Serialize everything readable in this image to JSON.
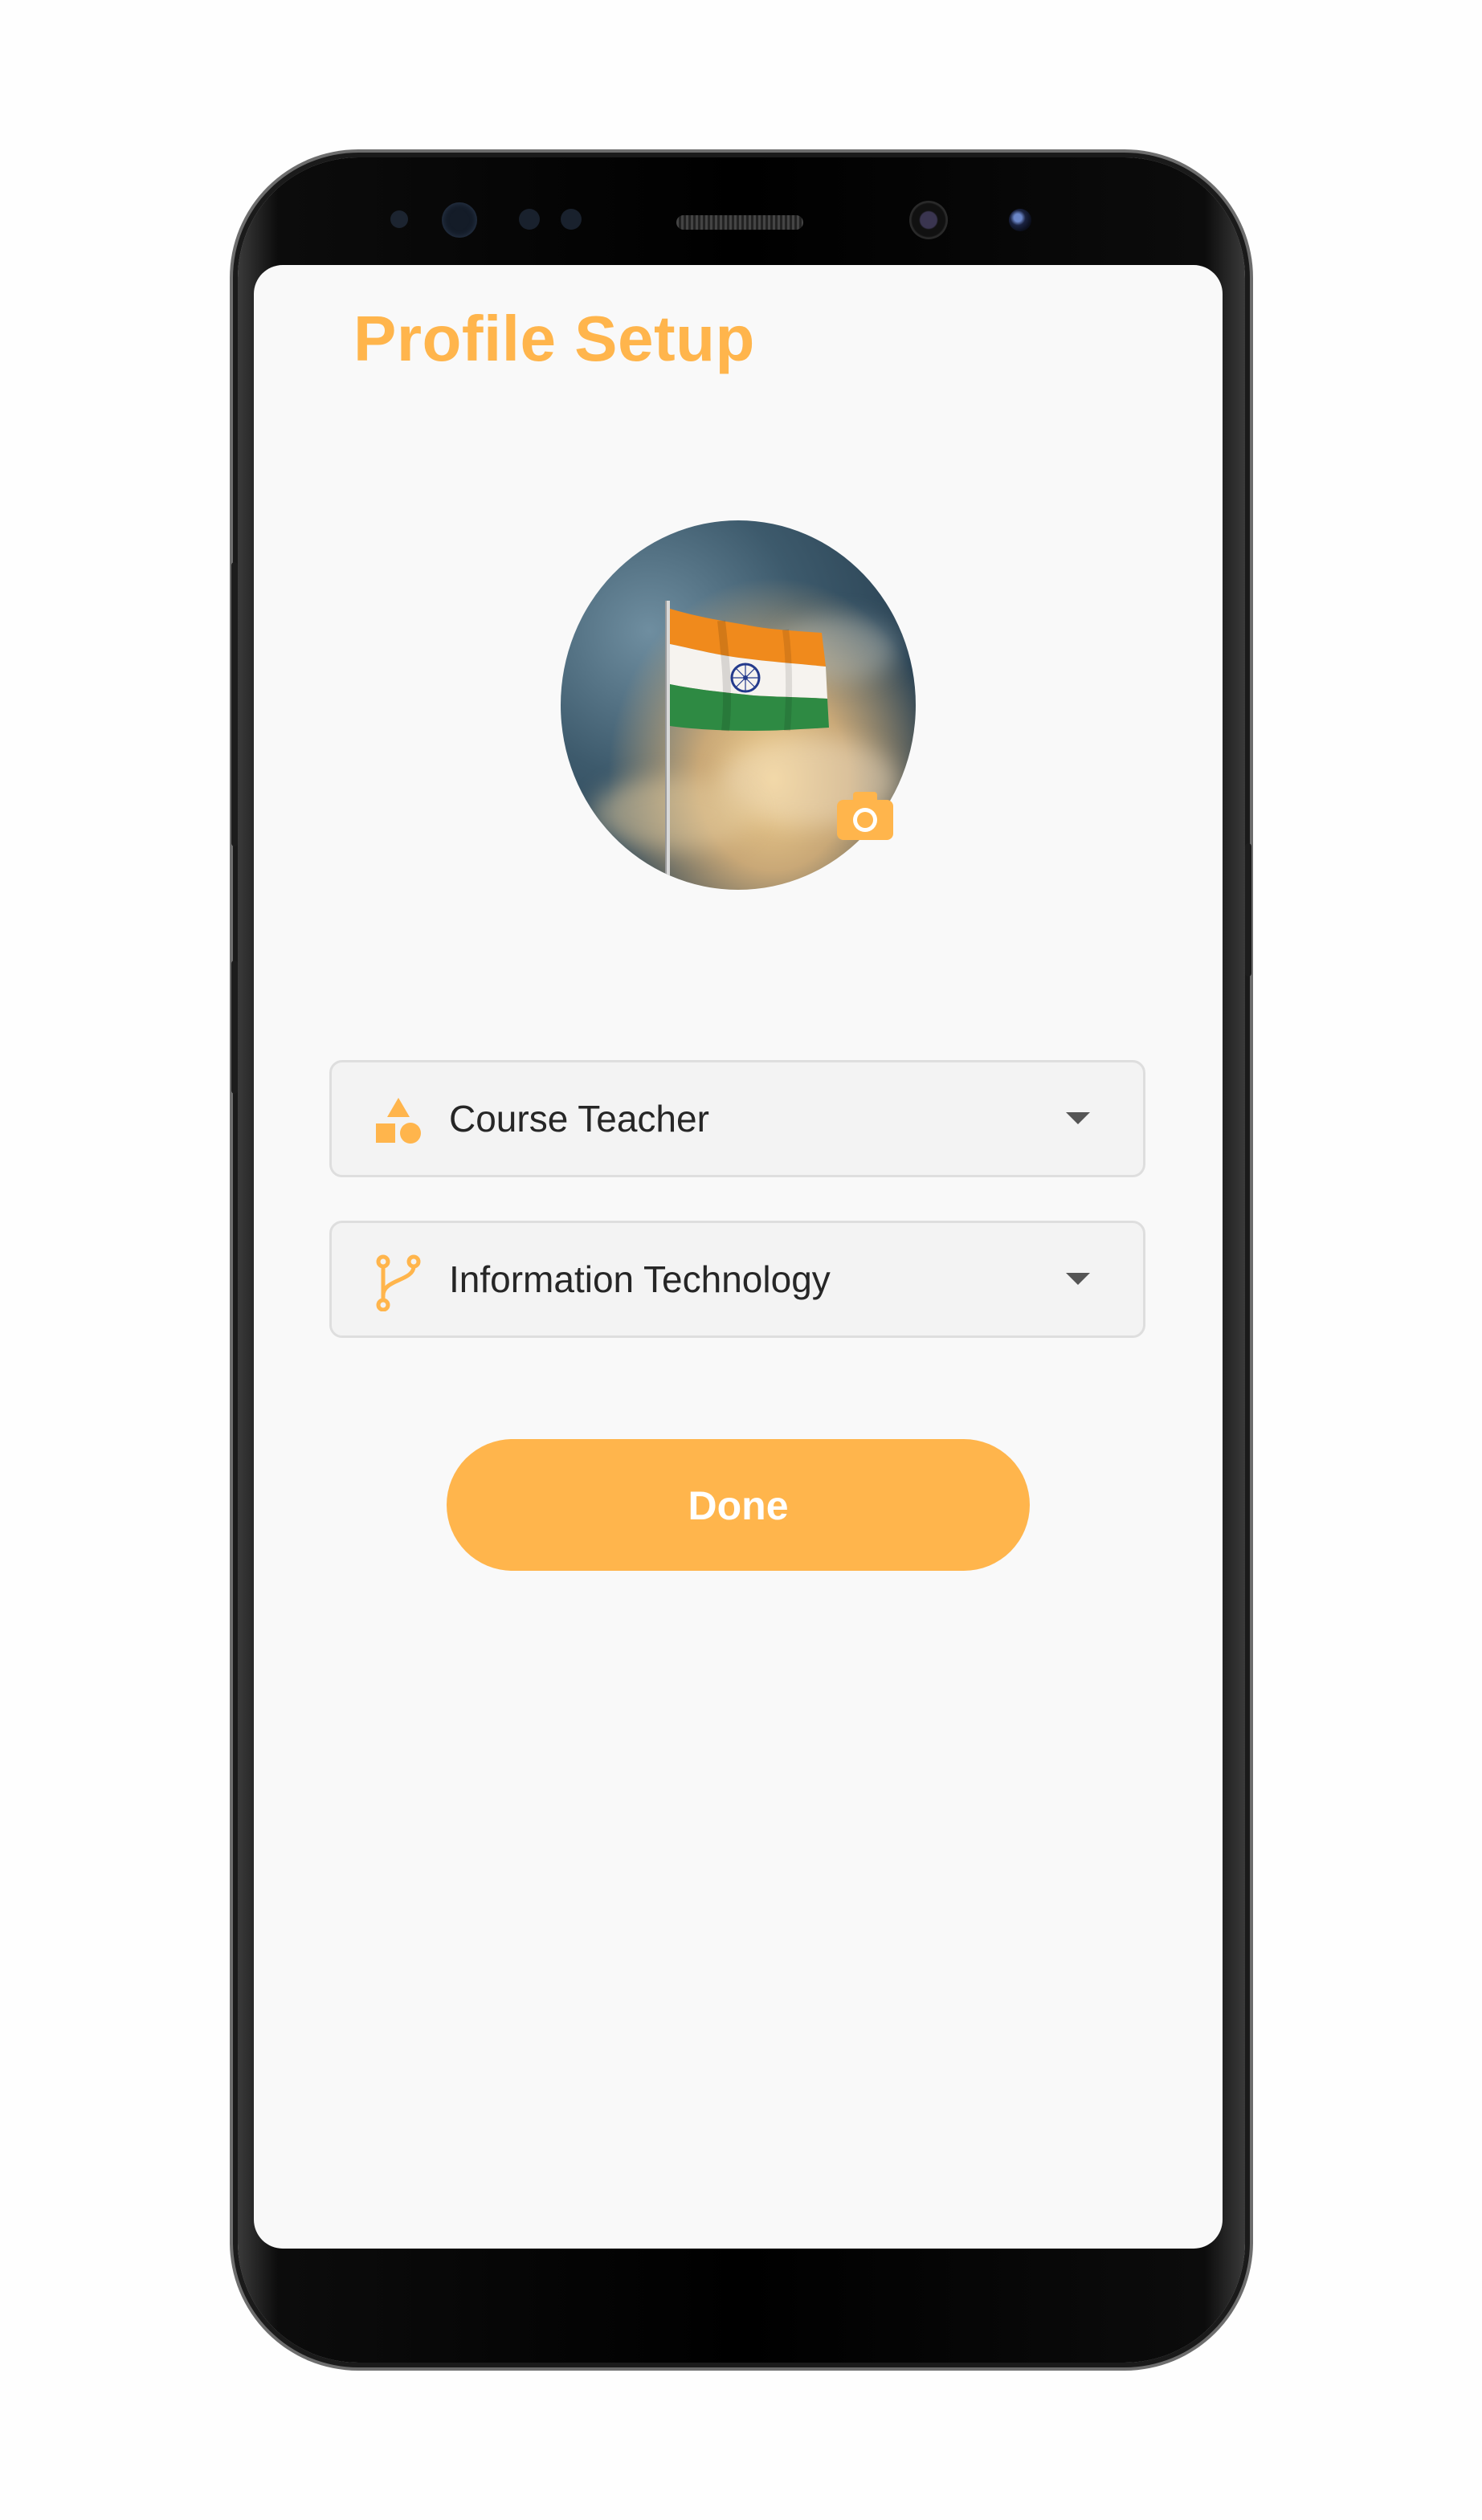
{
  "header": {
    "title": "Profile Setup"
  },
  "avatar": {
    "image_subject": "indian-flag-photo",
    "edit_icon": "camera-icon"
  },
  "form": {
    "role": {
      "selected": "Course Teacher",
      "icon": "category-shapes-icon"
    },
    "department": {
      "selected": "Information Technology",
      "icon": "branch-icon"
    },
    "done_label": "Done"
  },
  "colors": {
    "accent": "#ffb54c",
    "background": "#f9f9f9",
    "field_background": "#f3f3f3",
    "text": "#262626"
  }
}
